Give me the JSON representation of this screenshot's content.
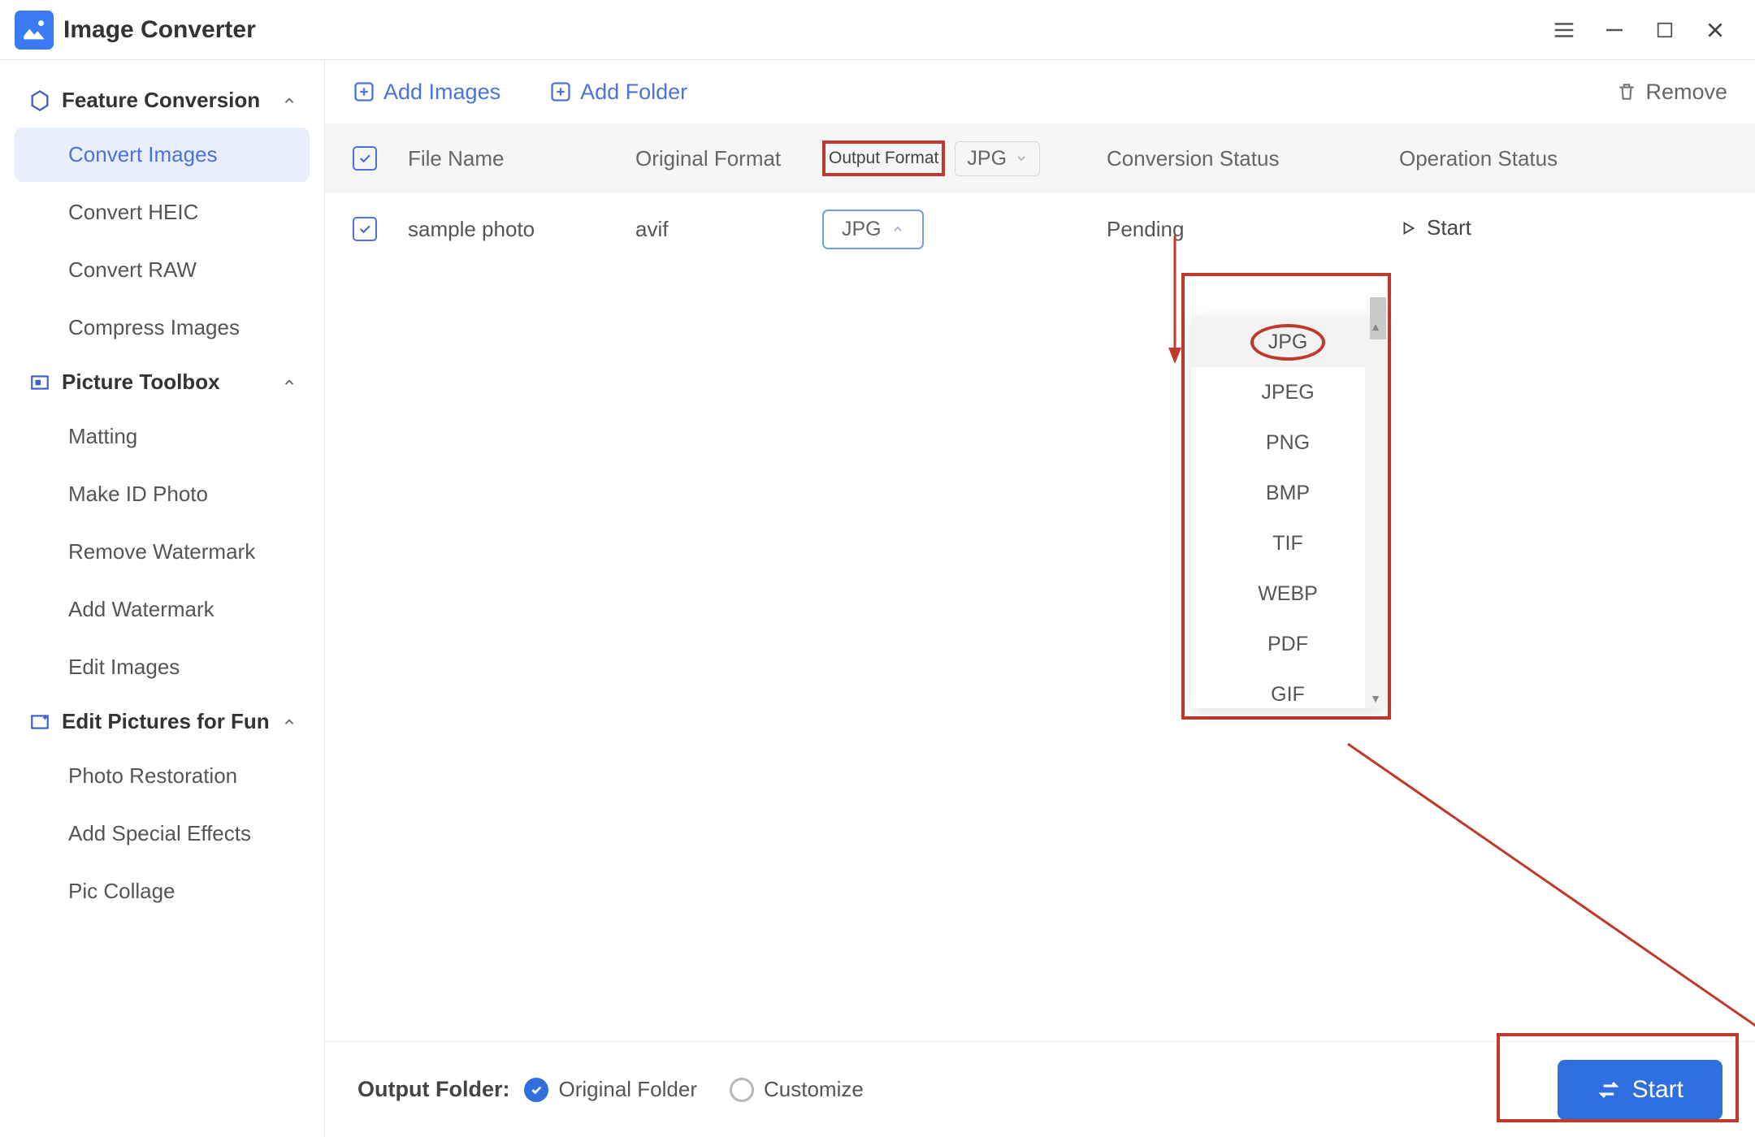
{
  "app": {
    "title": "Image Converter"
  },
  "sidebar": {
    "groups": [
      {
        "label": "Feature Conversion",
        "items": [
          "Convert Images",
          "Convert HEIC",
          "Convert RAW",
          "Compress Images"
        ]
      },
      {
        "label": "Picture Toolbox",
        "items": [
          "Matting",
          "Make ID Photo",
          "Remove Watermark",
          "Add Watermark",
          "Edit Images"
        ]
      },
      {
        "label": "Edit Pictures for Fun",
        "items": [
          "Photo Restoration",
          "Add Special Effects",
          "Pic Collage"
        ]
      }
    ]
  },
  "actions": {
    "add_images": "Add Images",
    "add_folder": "Add Folder",
    "remove": "Remove"
  },
  "table": {
    "headers": {
      "file_name": "File Name",
      "original_format": "Original Format",
      "output_format": "Output Format",
      "conv_status": "Conversion Status",
      "op_status": "Operation Status"
    },
    "output_format_header_value": "JPG",
    "rows": [
      {
        "file_name": "sample photo",
        "original_format": "avif",
        "output_format": "JPG",
        "conv_status": "Pending",
        "op": "Start"
      }
    ]
  },
  "dropdown": {
    "options": [
      "JPG",
      "JPEG",
      "PNG",
      "BMP",
      "TIF",
      "WEBP",
      "PDF",
      "GIF"
    ],
    "highlighted": "JPG"
  },
  "bottom": {
    "label": "Output Folder:",
    "options": [
      "Original Folder",
      "Customize"
    ],
    "selected_index": 0,
    "start": "Start"
  },
  "colors": {
    "accent": "#2f6fe0",
    "annotation": "#c0392b"
  }
}
